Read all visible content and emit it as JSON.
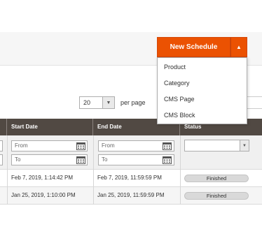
{
  "toolbar": {
    "new_schedule_label": "New Schedule",
    "dropdown_options": [
      "Product",
      "Category",
      "CMS Page",
      "CMS Block"
    ],
    "accent_color": "#eb5202"
  },
  "pager": {
    "per_page_value": "20",
    "per_page_label": "per page"
  },
  "grid": {
    "columns": [
      "Start Date",
      "End Date",
      "Status"
    ],
    "filters": {
      "start_from_placeholder": "From",
      "start_to_placeholder": "To",
      "end_from_placeholder": "From",
      "end_to_placeholder": "To"
    },
    "rows": [
      {
        "start": "Feb 7, 2019, 1:14:42 PM",
        "end": "Feb 7, 2019, 11:59:59 PM",
        "status": "Finished"
      },
      {
        "start": "Jan 25, 2019, 1:10:00 PM",
        "end": "Jan 25, 2019, 11:59:59 PM",
        "status": "Finished"
      }
    ]
  }
}
